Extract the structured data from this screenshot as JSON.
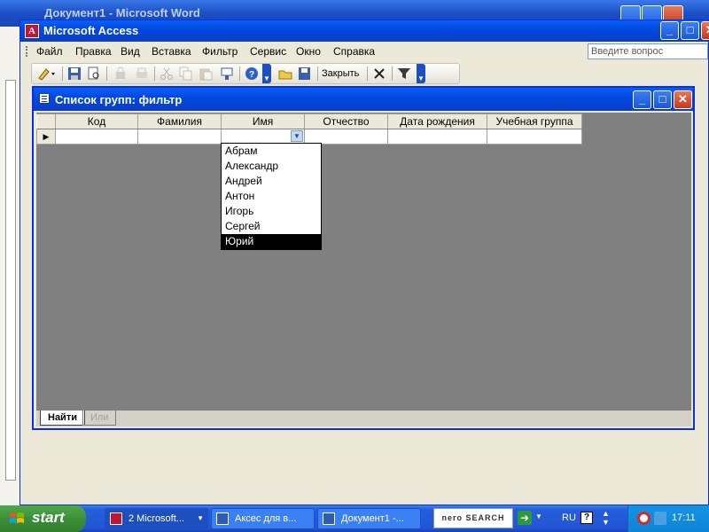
{
  "word_window": {
    "title": "Документ1 - Microsoft Word"
  },
  "access_window": {
    "title": "Microsoft Access",
    "icon_letter": "A"
  },
  "menubar": {
    "items": [
      "Файл",
      "Правка",
      "Вид",
      "Вставка",
      "Фильтр",
      "Сервис",
      "Окно",
      "Справка"
    ],
    "ask_placeholder": "Введите вопрос"
  },
  "toolbar": {
    "close_label": "Закрыть"
  },
  "child_window": {
    "title": "Список групп: фильтр"
  },
  "grid": {
    "columns": [
      "Код",
      "Фамилия",
      "Имя",
      "Отчество",
      "Дата рождения",
      "Учебная группа"
    ]
  },
  "dropdown": {
    "options": [
      "Абрам",
      "Александр",
      "Андрей",
      "Антон",
      "Игорь",
      "Сергей",
      "Юрий"
    ],
    "highlighted_index": 6
  },
  "tabs": {
    "find": "Найти",
    "or": "Или"
  },
  "taskbar": {
    "start": "start",
    "tasks": [
      "2 Microsoft...",
      "Аксес для в...",
      "Документ1 -..."
    ],
    "nero": "nero SEARCH",
    "language": "RU",
    "clock": "17:11"
  },
  "colors": {
    "titlebar": "#0a5ffa",
    "close": "#c2391a",
    "taskbar": "#245edb",
    "start": "#3c8f39"
  }
}
